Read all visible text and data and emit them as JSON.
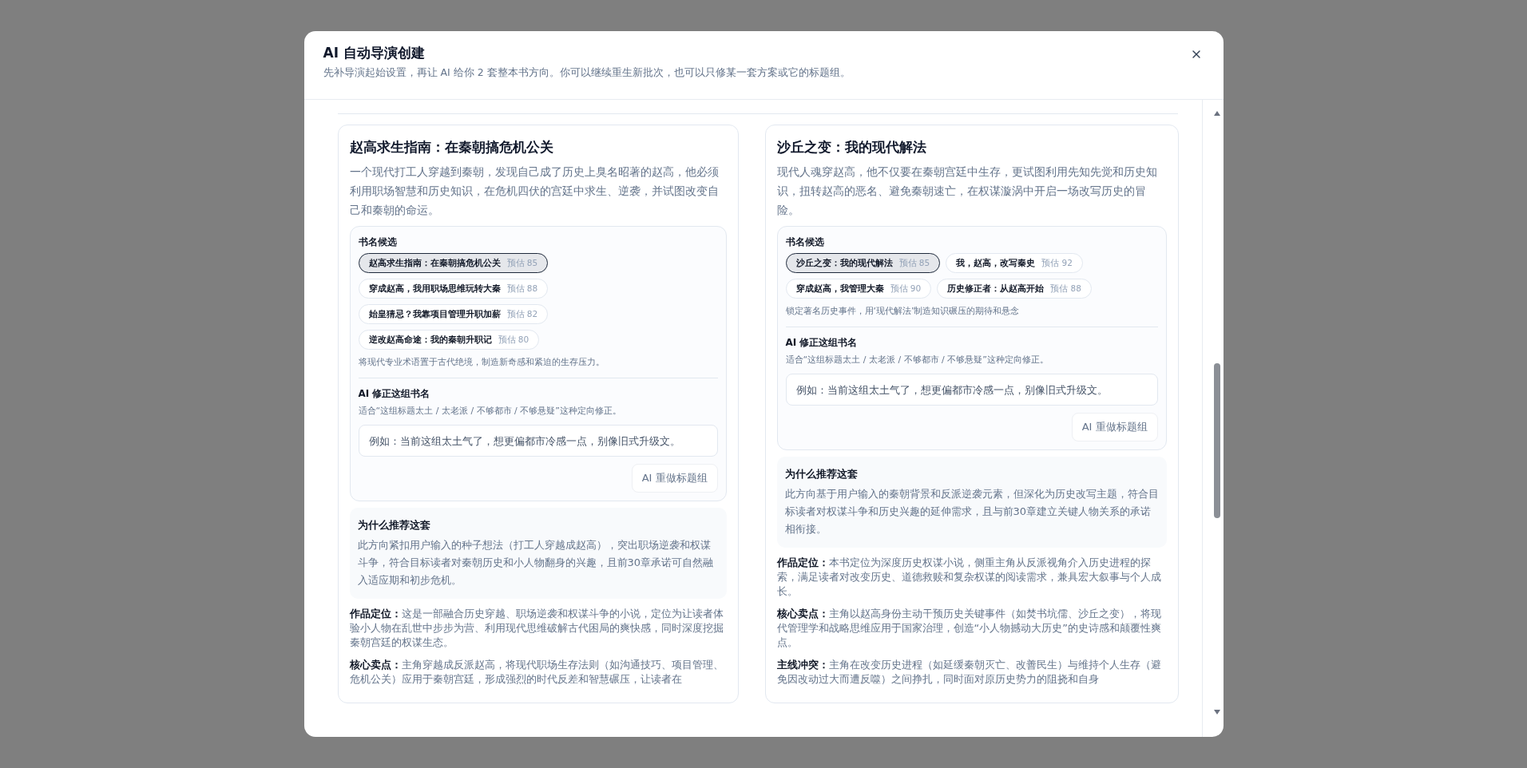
{
  "dialog": {
    "title": "AI 自动导演创建",
    "subtitle": "先补导演起始设置，再让 AI 给你 2 套整本书方向。你可以继续重生新批次，也可以只修某一套方案或它的标题组。"
  },
  "directions": [
    {
      "title": "赵高求生指南：在秦朝搞危机公关",
      "description": "一个现代打工人穿越到秦朝，发现自己成了历史上臭名昭著的赵高，他必须利用职场智慧和历史知识，在危机四伏的宫廷中求生、逆袭，并试图改变自己和秦朝的命运。",
      "candidates_heading": "书名候选",
      "candidates": [
        {
          "title": "赵高求生指南：在秦朝搞危机公关",
          "score": "预估 85",
          "selected": true
        },
        {
          "title": "穿成赵高，我用职场思维玩转大秦",
          "score": "预估 88",
          "selected": false
        },
        {
          "title": "始皇猜忌？我靠项目管理升职加薪",
          "score": "预估 82",
          "selected": false
        },
        {
          "title": "逆改赵高命途：我的秦朝升职记",
          "score": "预估 80",
          "selected": false
        }
      ],
      "candidate_note": "将现代专业术语置于古代绝境，制造新奇感和紧迫的生存压力。",
      "fix": {
        "heading": "AI 修正这组书名",
        "hint": "适合“这组标题太土 / 太老派 / 不够都市 / 不够悬疑”这种定向修正。",
        "placeholder": "例如：当前这组太土气了，想更偏都市冷感一点，别像旧式升级文。",
        "button": "AI 重做标题组"
      },
      "why": {
        "heading": "为什么推荐这套",
        "text": "此方向紧扣用户输入的种子想法（打工人穿越成赵高），突出职场逆袭和权谋斗争，符合目标读者对秦朝历史和小人物翻身的兴趣，且前30章承诺可自然融入适应期和初步危机。"
      },
      "details": [
        {
          "label": "作品定位：",
          "text": "这是一部融合历史穿越、职场逆袭和权谋斗争的小说，定位为让读者体验小人物在乱世中步步为营、利用现代思维破解古代困局的爽快感，同时深度挖掘秦朝宫廷的权谋生态。"
        },
        {
          "label": "核心卖点：",
          "text": "主角穿越成反派赵高，将现代职场生存法则（如沟通技巧、项目管理、危机公关）应用于秦朝宫廷，形成强烈的时代反差和智慧碾压，让读者在"
        }
      ]
    },
    {
      "title": "沙丘之变：我的现代解法",
      "description": "现代人魂穿赵高，他不仅要在秦朝宫廷中生存，更试图利用先知先觉和历史知识，扭转赵高的恶名、避免秦朝速亡，在权谋漩涡中开启一场改写历史的冒险。",
      "candidates_heading": "书名候选",
      "candidates": [
        {
          "title": "沙丘之变：我的现代解法",
          "score": "预估 85",
          "selected": true
        },
        {
          "title": "我，赵高，改写秦史",
          "score": "预估 92",
          "selected": false
        },
        {
          "title": "穿成赵高，我管理大秦",
          "score": "预估 90",
          "selected": false
        },
        {
          "title": "历史修正者：从赵高开始",
          "score": "预估 88",
          "selected": false
        }
      ],
      "candidate_note": "锁定著名历史事件，用‘现代解法’制造知识碾压的期待和悬念",
      "fix": {
        "heading": "AI 修正这组书名",
        "hint": "适合“这组标题太土 / 太老派 / 不够都市 / 不够悬疑”这种定向修正。",
        "placeholder": "例如：当前这组太土气了，想更偏都市冷感一点，别像旧式升级文。",
        "button": "AI 重做标题组"
      },
      "why": {
        "heading": "为什么推荐这套",
        "text": "此方向基于用户输入的秦朝背景和反派逆袭元素，但深化为历史改写主题，符合目标读者对权谋斗争和历史兴趣的延伸需求，且与前30章建立关键人物关系的承诺相衔接。"
      },
      "details": [
        {
          "label": "作品定位：",
          "text": "本书定位为深度历史权谋小说，侧重主角从反派视角介入历史进程的探索，满足读者对改变历史、道德救赎和复杂权谋的阅读需求，兼具宏大叙事与个人成长。"
        },
        {
          "label": "核心卖点：",
          "text": "主角以赵高身份主动干预历史关键事件（如焚书坑儒、沙丘之变），将现代管理学和战略思维应用于国家治理，创造“小人物撼动大历史”的史诗感和颠覆性爽点。"
        },
        {
          "label": "主线冲突：",
          "text": "主角在改变历史进程（如延缓秦朝灭亡、改善民生）与维持个人生存（避免因改动过大而遭反噬）之间挣扎，同时面对原历史势力的阻挠和自身"
        }
      ]
    }
  ]
}
